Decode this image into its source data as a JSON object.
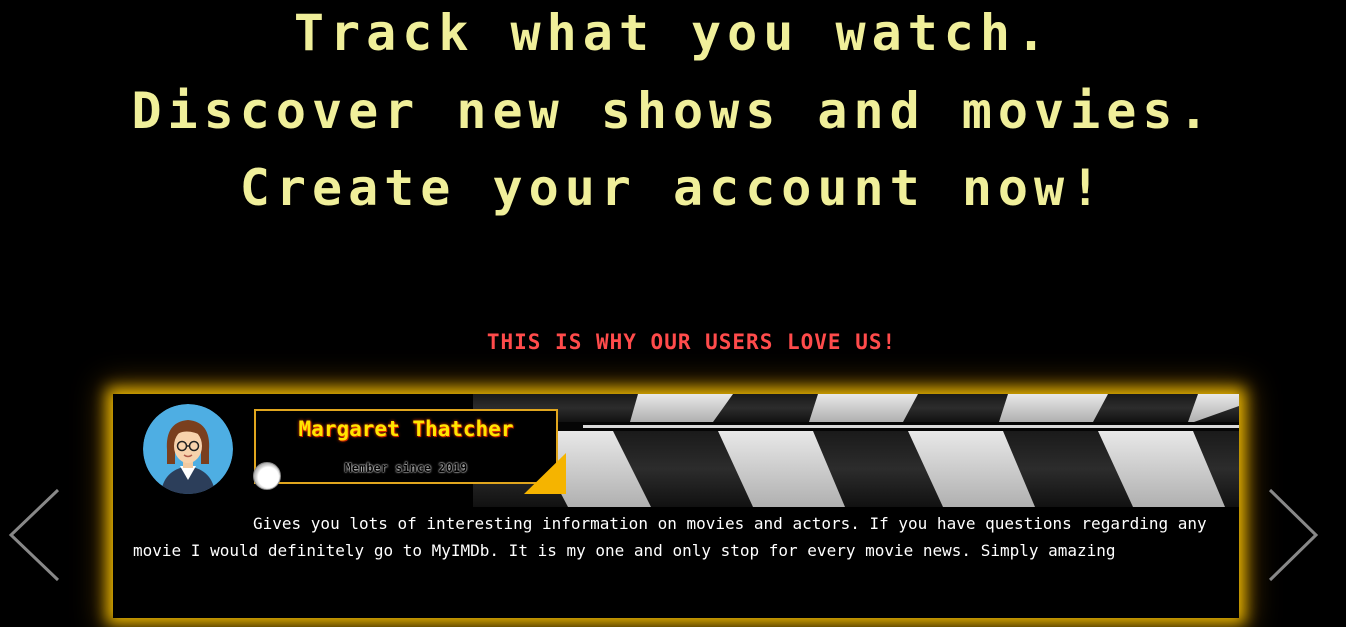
{
  "hero": {
    "line1": "Track what you watch.",
    "line2": "Discover new shows and movies.",
    "line3": "Create your account now!"
  },
  "testimonials": {
    "heading": "THIS IS WHY OUR USERS LOVE US!",
    "current": {
      "name": "Margaret Thatcher",
      "member_since": "Member since 2019",
      "review": "Gives you lots of interesting information on movies and actors. If you have questions regarding any movie I would definitely go to MyIMDb. It is my one and only stop for every movie news. Simply amazing"
    },
    "prev_icon": "chevron-left-icon",
    "next_icon": "chevron-right-icon"
  },
  "colors": {
    "hero_text": "#f0ef9a",
    "heading": "#ff4b4b",
    "card_glow": "#ffc800",
    "name": "#ffe600",
    "accent": "#f5b400",
    "background": "#000000"
  }
}
